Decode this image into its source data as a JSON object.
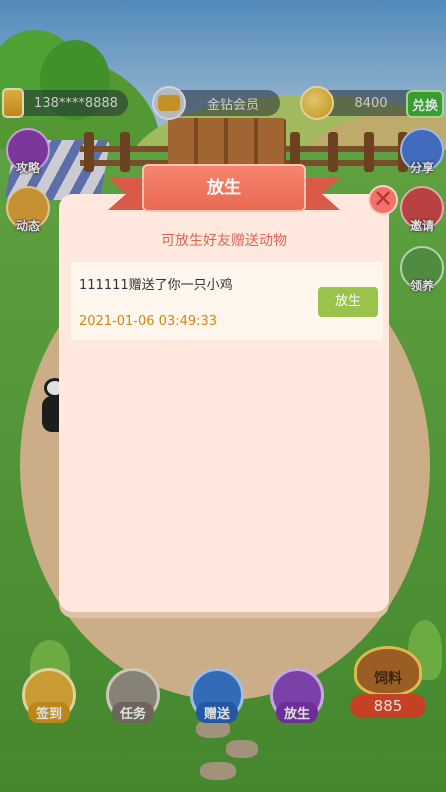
{
  "topbar": {
    "user_phone": "138****8888",
    "vip_level": "金钻会员",
    "coins": "8400",
    "redeem_label": "兑换"
  },
  "side_left": {
    "guide_label": "攻略",
    "news_label": "动态"
  },
  "side_right": {
    "share_label": "分享",
    "invite_label": "邀请",
    "adopt_label": "领养"
  },
  "bottom": {
    "checkin_label": "签到",
    "task_label": "任务",
    "gift_label": "赠送",
    "release_label": "放生",
    "feed_label": "饲料",
    "feed_count": "885"
  },
  "modal": {
    "title": "放生",
    "subtitle": "可放生好友赠送动物",
    "records": [
      {
        "message": "111111赠送了你一只小鸡",
        "time": "2021-01-06 03:49:33",
        "action_label": "放生"
      }
    ]
  },
  "colors": {
    "accent": "#ea6a52",
    "release_button": "#9ac34c",
    "timestamp": "#d4870e"
  }
}
